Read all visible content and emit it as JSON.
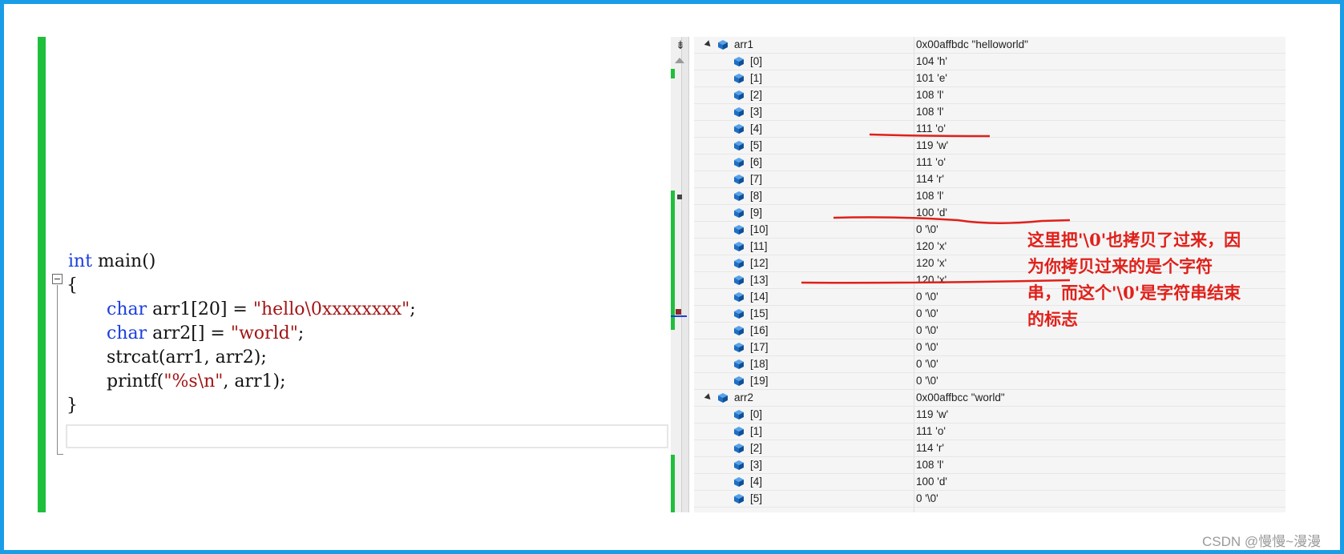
{
  "editor": {
    "lines": [
      {
        "kw": "int",
        "rest": " main()"
      },
      {
        "plain": "{"
      },
      {
        "kw": "char",
        "rest1": " arr1[20] = ",
        "str": "\"hello\\0xxxxxxxx\"",
        "rest2": ";"
      },
      {
        "kw": "char",
        "rest1": " arr2[] = ",
        "str": "\"world\"",
        "rest2": ";"
      },
      {
        "plain": "strcat(arr1, arr2);"
      },
      {
        "rest1": "printf(",
        "str": "\"%s\\n\"",
        "rest2": ", arr1);"
      },
      {
        "plain": "}"
      }
    ]
  },
  "watch": {
    "arr1": {
      "name": "arr1",
      "value": "0x00affbdc \"helloworld\"",
      "items": [
        {
          "idx": "[0]",
          "val": "104 'h'"
        },
        {
          "idx": "[1]",
          "val": "101 'e'"
        },
        {
          "idx": "[2]",
          "val": "108 'l'"
        },
        {
          "idx": "[3]",
          "val": "108 'l'"
        },
        {
          "idx": "[4]",
          "val": "111 'o'"
        },
        {
          "idx": "[5]",
          "val": "119 'w'"
        },
        {
          "idx": "[6]",
          "val": "111 'o'"
        },
        {
          "idx": "[7]",
          "val": "114 'r'"
        },
        {
          "idx": "[8]",
          "val": "108 'l'"
        },
        {
          "idx": "[9]",
          "val": "100 'd'"
        },
        {
          "idx": "[10]",
          "val": "0 '\\0'"
        },
        {
          "idx": "[11]",
          "val": "120 'x'"
        },
        {
          "idx": "[12]",
          "val": "120 'x'"
        },
        {
          "idx": "[13]",
          "val": "120 'x'"
        },
        {
          "idx": "[14]",
          "val": "0 '\\0'"
        },
        {
          "idx": "[15]",
          "val": "0 '\\0'"
        },
        {
          "idx": "[16]",
          "val": "0 '\\0'"
        },
        {
          "idx": "[17]",
          "val": "0 '\\0'"
        },
        {
          "idx": "[18]",
          "val": "0 '\\0'"
        },
        {
          "idx": "[19]",
          "val": "0 '\\0'"
        }
      ]
    },
    "arr2": {
      "name": "arr2",
      "value": "0x00affbcc \"world\"",
      "items": [
        {
          "idx": "[0]",
          "val": "119 'w'"
        },
        {
          "idx": "[1]",
          "val": "111 'o'"
        },
        {
          "idx": "[2]",
          "val": "114 'r'"
        },
        {
          "idx": "[3]",
          "val": "108 'l'"
        },
        {
          "idx": "[4]",
          "val": "100 'd'"
        },
        {
          "idx": "[5]",
          "val": "0 '\\0'"
        }
      ]
    }
  },
  "annotation": {
    "lines": [
      "这里把'\\0'也拷贝了过来，因",
      "为你拷贝过来的是个字符",
      "串，而这个'\\0'是字符串结束",
      "的标志"
    ]
  },
  "watermark": "CSDN @慢慢~漫漫",
  "colors": {
    "border": "#1a9de6",
    "keyword": "#1a3ee0",
    "string": "#a31515",
    "change_bar": "#1fbf3c",
    "annotation": "#e0201a",
    "cube_icon": "#1f6fc4"
  }
}
